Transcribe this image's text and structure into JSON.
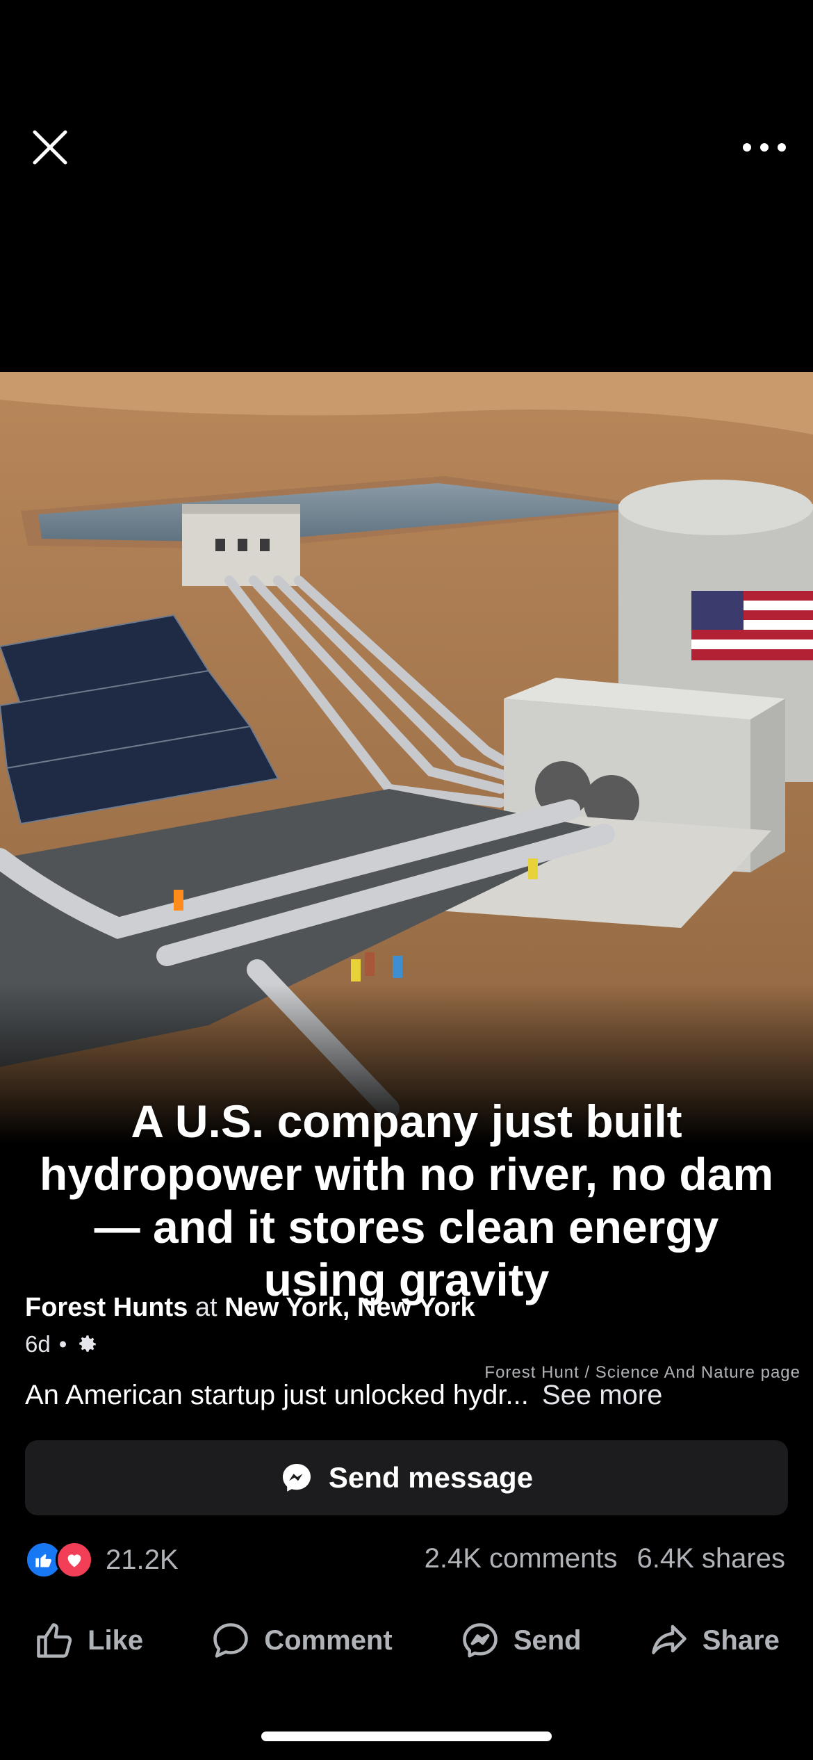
{
  "post": {
    "headline": "A U.S. company just built hydropower with no river, no dam — and it stores clean energy using gravity",
    "author": "Forest Hunts",
    "location_prefix": "at",
    "location": "New York, New York",
    "time": "6d",
    "separator": "•",
    "watermark": "Forest Hunt / Science And Nature page",
    "caption": "An American startup just unlocked hydr...",
    "see_more": "See more"
  },
  "buttons": {
    "send_message": "Send message"
  },
  "stats": {
    "reactions": "21.2K",
    "comments": "2.4K comments",
    "shares": "6.4K shares"
  },
  "actions": {
    "like": "Like",
    "comment": "Comment",
    "send": "Send",
    "share": "Share"
  },
  "icons": {
    "close": "close-icon",
    "more": "more-horizontal-icon",
    "privacy": "gear-icon",
    "messenger": "messenger-icon",
    "like_reaction": "thumbs-up-icon",
    "love_reaction": "heart-icon",
    "comment": "comment-bubble-icon",
    "share": "share-arrow-icon"
  },
  "colors": {
    "background": "#000000",
    "button_bg": "#1c1c1e",
    "like_blue": "#1877f2",
    "love_red": "#f33e58",
    "secondary_text": "#b0b3b8"
  }
}
